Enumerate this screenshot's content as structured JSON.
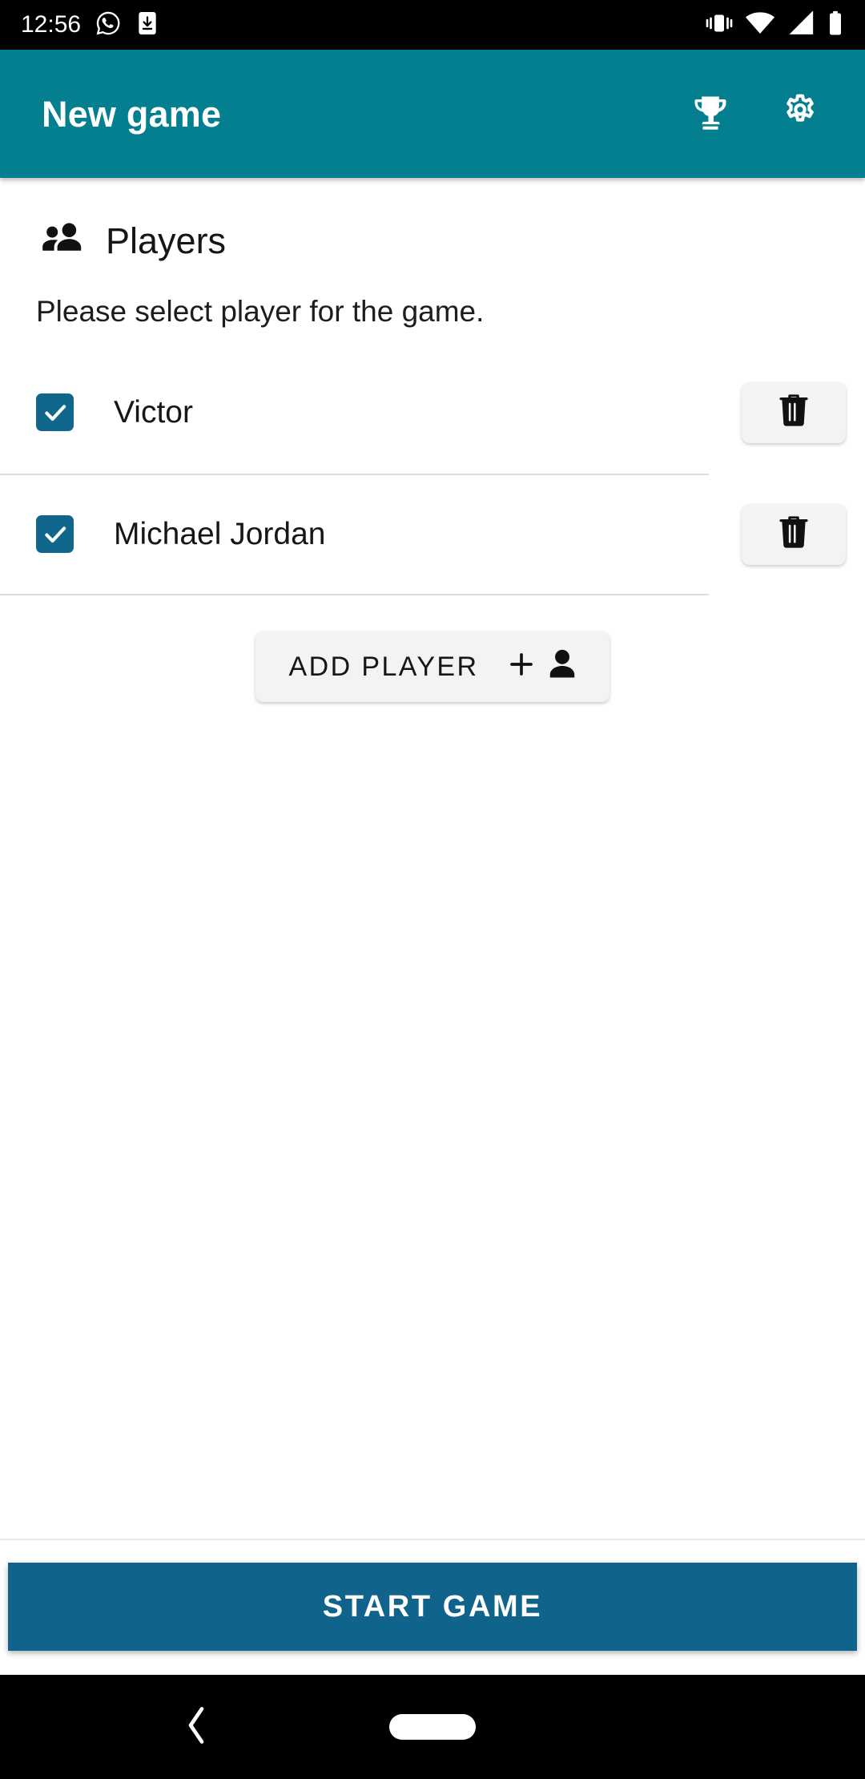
{
  "status_bar": {
    "time": "12:56",
    "left_icons": [
      "whatsapp-icon",
      "download-icon"
    ],
    "right_icons": [
      "vibrate-icon",
      "wifi-icon",
      "signal-icon",
      "battery-icon"
    ],
    "background_color": "#000000"
  },
  "app_bar": {
    "title": "New game",
    "background_color": "#047f8f",
    "actions": [
      {
        "name": "trophy-icon",
        "label": "Achievements"
      },
      {
        "name": "gear-icon",
        "label": "Settings"
      }
    ]
  },
  "main": {
    "section": {
      "icon": "people-icon",
      "title": "Players",
      "subtitle": "Please select player for the game."
    },
    "players": [
      {
        "name": "Victor",
        "checked": true,
        "delete_icon": "trash-icon"
      },
      {
        "name": "Michael Jordan",
        "checked": true,
        "delete_icon": "trash-icon"
      }
    ],
    "add_player": {
      "label": "ADD PLAYER",
      "icons": [
        "plus-icon",
        "person-icon"
      ]
    }
  },
  "footer": {
    "start_button": {
      "label": "START GAME",
      "color": "#10648c"
    }
  },
  "nav_bar": {
    "back": "back-chevron-icon",
    "home": "home-pill-indicator"
  },
  "colors": {
    "accent_teal": "#047f8f",
    "accent_blue": "#11678b",
    "start_blue": "#10648c",
    "chip_gray": "#f3f3f3",
    "divider": "#dddddd"
  }
}
